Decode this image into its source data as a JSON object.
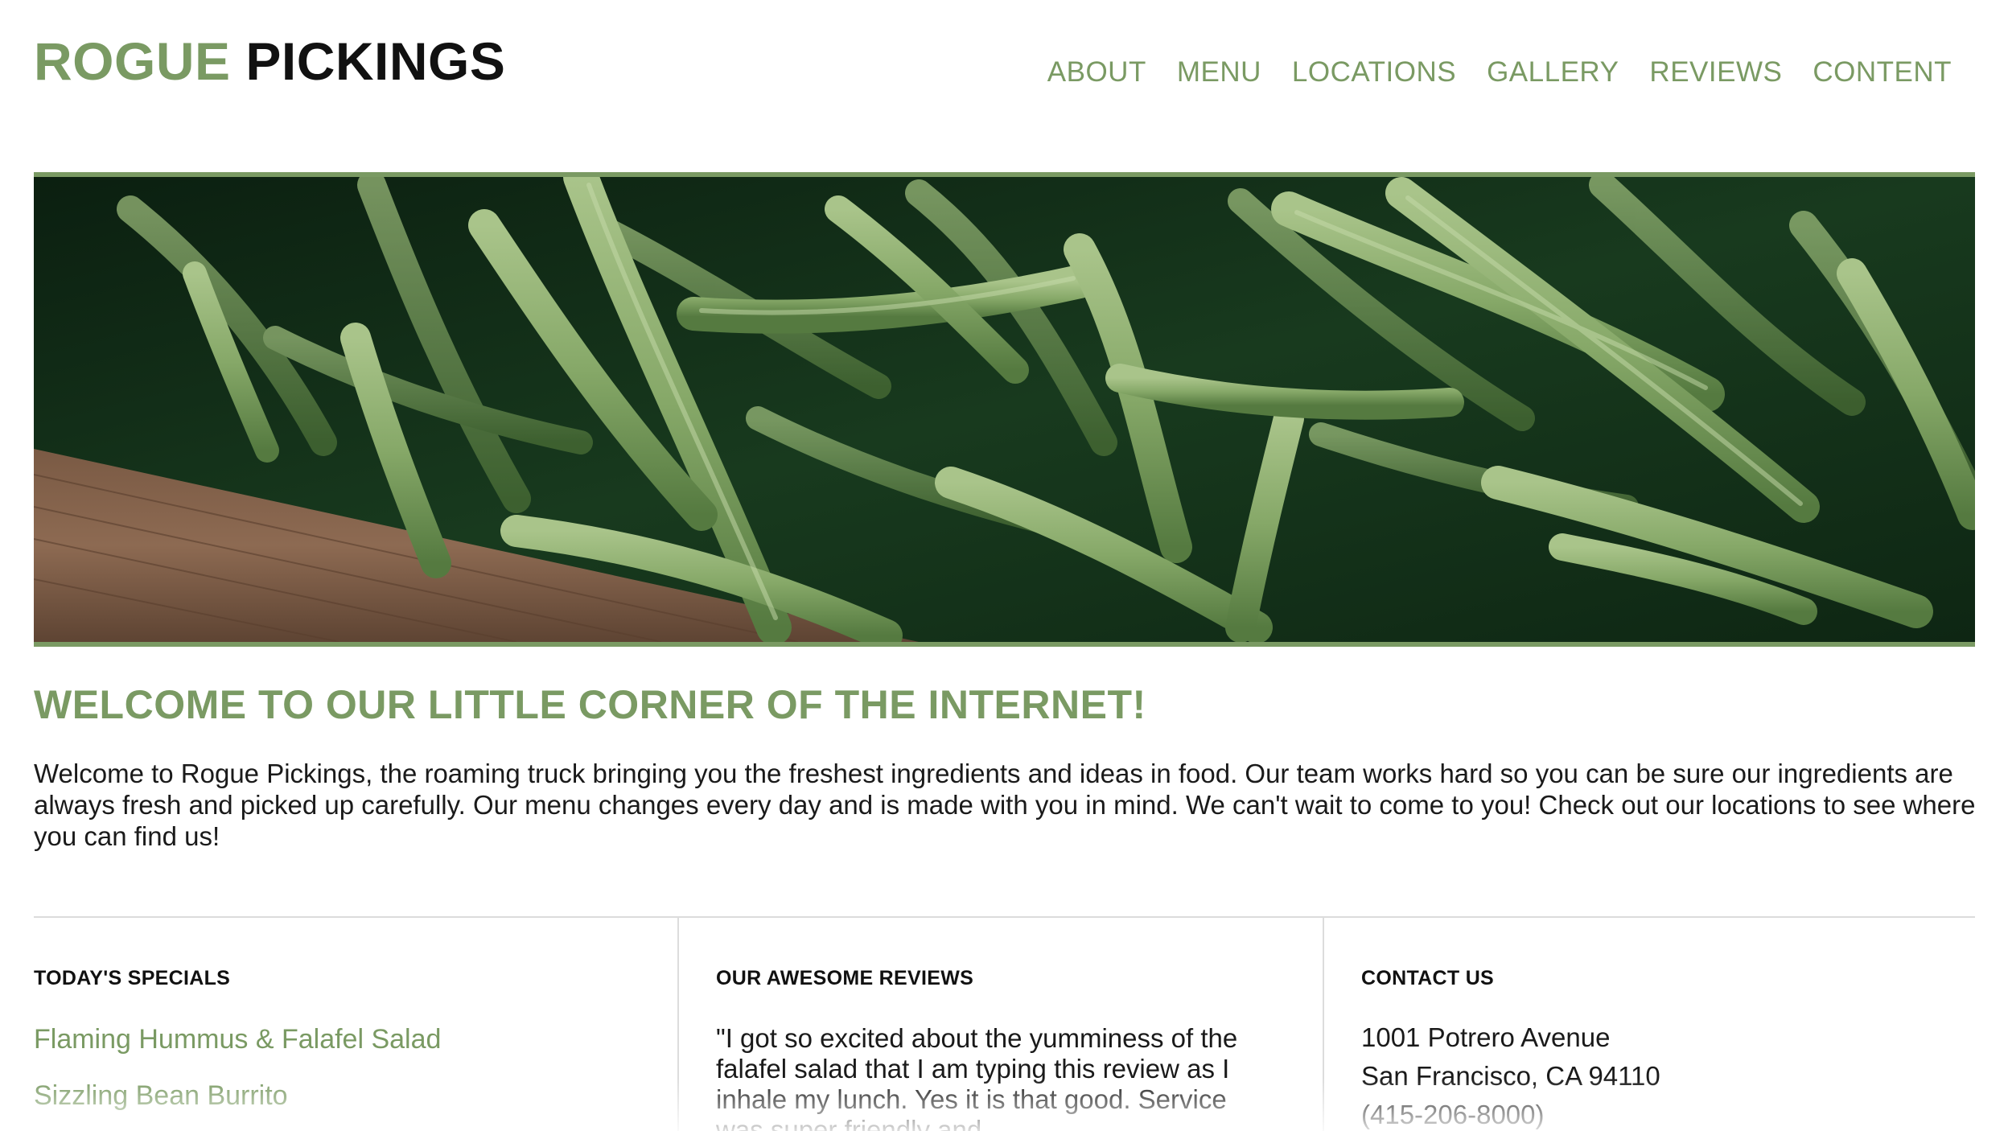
{
  "header": {
    "logo_part1": "ROGUE",
    "logo_part2": "PICKINGS",
    "nav": [
      "ABOUT",
      "MENU",
      "LOCATIONS",
      "GALLERY",
      "REVIEWS",
      "CONTENT"
    ]
  },
  "hero": {
    "image_subject": "green beans in wooden crate"
  },
  "welcome": {
    "title": "WELCOME TO OUR LITTLE CORNER OF THE INTERNET!",
    "body": "Welcome to Rogue Pickings, the roaming truck bringing you the freshest ingredients and ideas in food. Our team works hard so you can be sure our ingredients are always fresh and picked up carefully. Our menu changes every day and is made with you in mind. We can't wait to come to you! Check out our locations to see where you can find us!"
  },
  "specials": {
    "heading": "TODAY'S SPECIALS",
    "items": [
      "Flaming Hummus & Falafel Salad",
      "Sizzling Bean Burrito"
    ]
  },
  "reviews": {
    "heading": "OUR AWESOME REVIEWS",
    "text": "\"I got so excited about the yumminess of the falafel salad that I am typing this review as I inhale my lunch. Yes it is that good. Service was super friendly and"
  },
  "contact": {
    "heading": "CONTACT US",
    "address1": "1001 Potrero Avenue",
    "address2": "San Francisco, CA 94110",
    "phone": "(415-206-8000)"
  },
  "colors": {
    "accent": "#7a9a63",
    "text": "#1a1a1a",
    "divider": "#dcdcdc"
  }
}
